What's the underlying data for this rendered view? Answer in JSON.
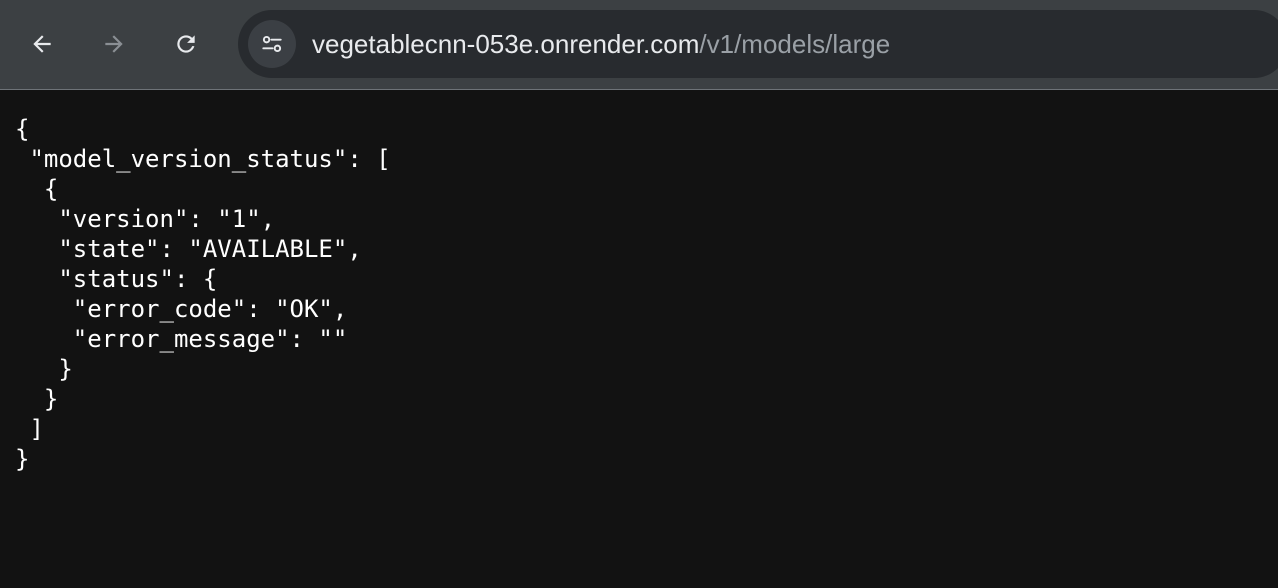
{
  "browser": {
    "back_icon": "arrow-left-icon",
    "forward_icon": "arrow-right-icon",
    "reload_icon": "reload-icon",
    "site_info_icon": "tune-icon",
    "url_host": "vegetablecnn-053e.onrender.com",
    "url_path": "/v1/models/large"
  },
  "page": {
    "json_lines": [
      "{",
      " \"model_version_status\": [",
      "  {",
      "   \"version\": \"1\",",
      "   \"state\": \"AVAILABLE\",",
      "   \"status\": {",
      "    \"error_code\": \"OK\",",
      "    \"error_message\": \"\"",
      "   }",
      "  }",
      " ]",
      "}"
    ]
  },
  "colors": {
    "toolbar_bg": "#3c4043",
    "omnibox_bg": "#282b2f",
    "page_bg": "#121212",
    "text": "#ffffff"
  }
}
